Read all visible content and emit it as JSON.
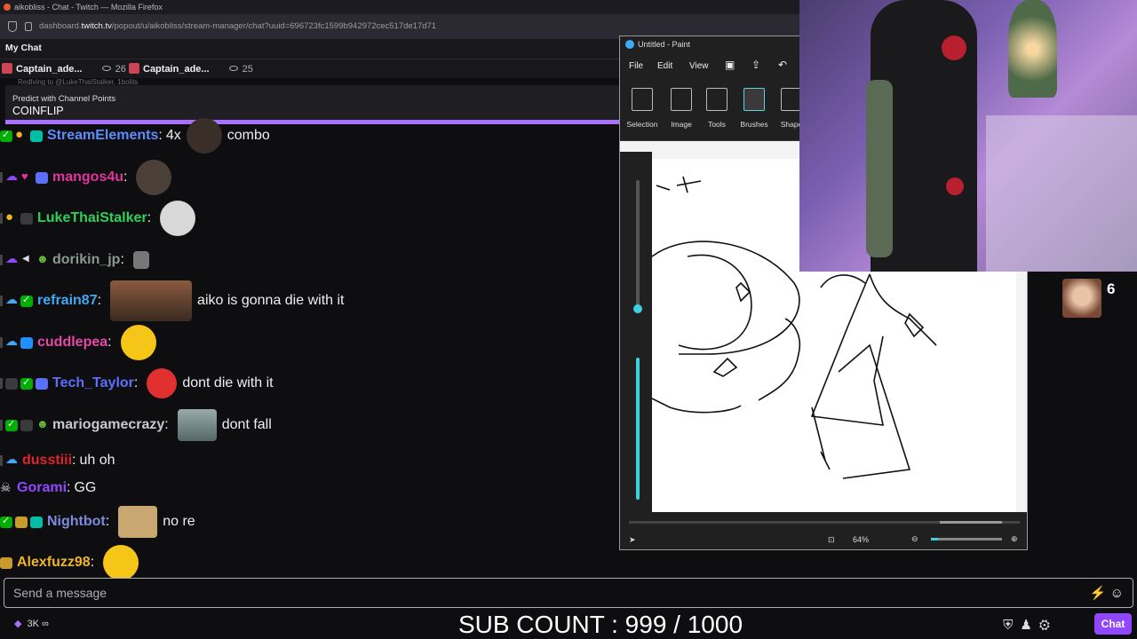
{
  "browser": {
    "title": "aikobliss - Chat - Twitch — Mozilla Firefox",
    "url_prefix": "dashboard.",
    "url_domain": "twitch.tv",
    "url_path": "/popout/u/aikobliss/stream-manager/chat?uuid=696723fc1599b942972cec517de17d71"
  },
  "chat": {
    "header": "My Chat",
    "tabs": [
      {
        "name": "Captain_ade...",
        "count": "26"
      },
      {
        "name": "Captain_ade...",
        "count": "25"
      }
    ],
    "faded_line": "Redlving to @LukeThaiStalker, 1bolits",
    "prediction": {
      "label": "Predict with Channel Points",
      "value": "COINFLIP"
    },
    "messages": [
      {
        "user": "StreamElements",
        "color": "#5c8dff",
        "text_before": "4x",
        "text": "combo"
      },
      {
        "user": "mangos4u",
        "color": "#e0359d",
        "text": ""
      },
      {
        "user": "LukeThaiStalker",
        "color": "#2fd05a",
        "text": ""
      },
      {
        "user": "dorikin_jp",
        "color": "#8a9a8f",
        "text": ""
      },
      {
        "user": "refrain87",
        "color": "#3fa9f5",
        "text": "aiko is gonna die with it"
      },
      {
        "user": "cuddlepea",
        "color": "#e34aa8",
        "text": ""
      },
      {
        "user": "Tech_Taylor",
        "color": "#5c6ffa",
        "text": "dont die with it"
      },
      {
        "user": "mariogamecrazy",
        "color": "#c8c8d0",
        "text": "dont fall"
      },
      {
        "user": "dusstiii",
        "color": "#e0242e",
        "text": "uh oh"
      },
      {
        "user": "Gorami",
        "color": "#9147ff",
        "text": "GG"
      },
      {
        "user": "Nightbot",
        "color": "#7b8cde",
        "text": "no re"
      },
      {
        "user": "Alexfuzz98",
        "color": "#f0b429",
        "text": ""
      }
    ],
    "input_placeholder": "Send a message",
    "points": "3K",
    "infinity": "∞",
    "subcount": "SUB COUNT : 999 / 1000",
    "chat_button": "Chat"
  },
  "paint": {
    "title": "Untitled - Paint",
    "menu": [
      "File",
      "Edit",
      "View"
    ],
    "tools": [
      "Selection",
      "Image",
      "Tools",
      "Brushes",
      "Shape"
    ],
    "zoom": "64%"
  },
  "overlay": {
    "viewer_count": "6"
  }
}
